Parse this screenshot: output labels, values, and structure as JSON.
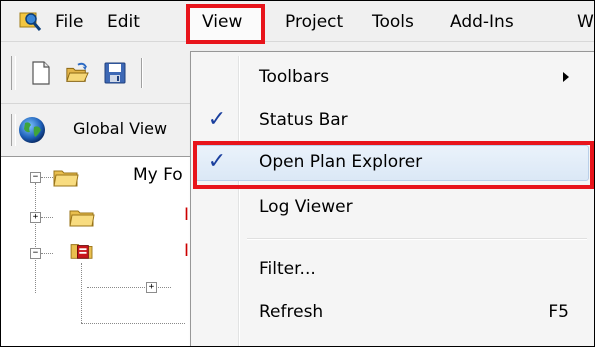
{
  "menubar": {
    "items": [
      "File",
      "Edit",
      "View",
      "Project",
      "Tools",
      "Add-Ins",
      "W"
    ]
  },
  "toolbar": {
    "buttons": [
      "new-document-icon",
      "open-folder-icon",
      "save-icon"
    ]
  },
  "global_view": {
    "label": "Global View"
  },
  "tree": {
    "root_label": "My Fo",
    "child_marks": [
      "I",
      "I"
    ]
  },
  "view_menu": {
    "items": [
      {
        "label": "Toolbars",
        "checked": false,
        "submenu": true
      },
      {
        "label": "Status Bar",
        "checked": true
      },
      {
        "label": "Open Plan Explorer",
        "checked": true
      },
      {
        "label": "Log Viewer",
        "checked": false
      },
      {
        "label": "Filter...",
        "checked": false
      },
      {
        "label": "Refresh",
        "checked": false,
        "shortcut": "F5"
      }
    ],
    "check_glyph": "✓"
  },
  "colors": {
    "highlight_red": "#e8141b",
    "check_blue": "#1a3f9e",
    "menu_bg": "#f5f5f5"
  }
}
